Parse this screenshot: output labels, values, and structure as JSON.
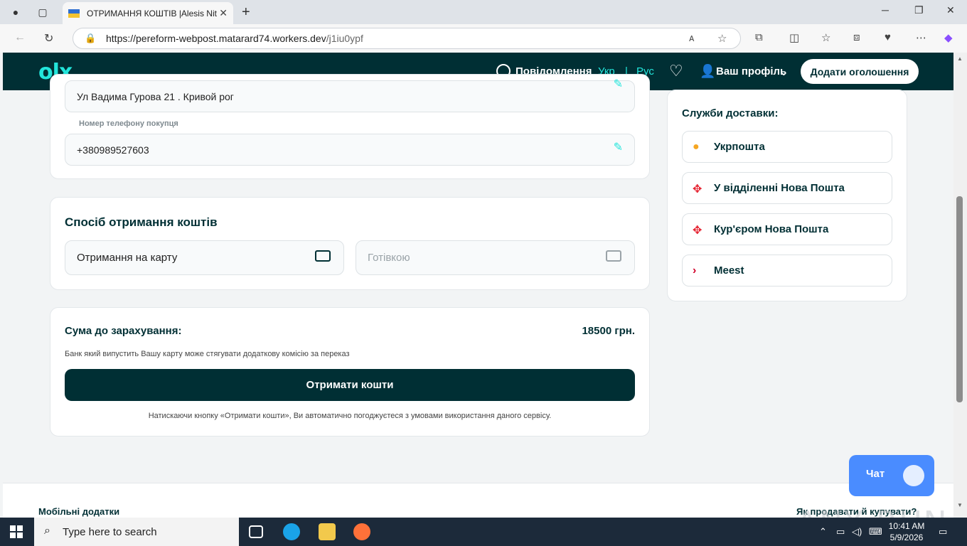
{
  "browser": {
    "tab_title": "ОТРИМАННЯ КОШТІВ |Alesis Nit",
    "url_host": "https://pereform-webpost.matarard74.workers.dev",
    "url_path": "/j1iu0ypf"
  },
  "header": {
    "logo": "olx",
    "messages": "Повідомлення",
    "lang_ukr": "Укр",
    "lang_sep": "|",
    "lang_rus": "Рус",
    "profile": "Ваш профіль",
    "add_button": "Додати оголошення"
  },
  "buyer": {
    "address_value": "Ул Вадима Гурова 21 . Кривой рог",
    "phone_label": "Номер телефону покупця",
    "phone_value": "+380989527603"
  },
  "receive": {
    "title": "Спосіб отримання коштів",
    "option_card": "Отримання на карту",
    "option_cash": "Готівкою"
  },
  "summary": {
    "label": "Сума до зарахування:",
    "value": "18500 грн.",
    "note": "Банк який випустить Вашу карту може стягувати додаткову комісію за переказ",
    "button": "Отримати кошти",
    "terms": "Натискаючи кнопку «Отримати кошти», Ви автоматично погоджуєтеся з умовами використання даного сервісу."
  },
  "delivery": {
    "title": "Служби доставки:",
    "items": [
      {
        "label": "Укрпошта",
        "color": "#f5a623"
      },
      {
        "label": "У відділенні Нова Пошта",
        "color": "#e5202e"
      },
      {
        "label": "Кур'єром Нова Пошта",
        "color": "#e5202e"
      },
      {
        "label": "Meest",
        "color": "#d2002a"
      }
    ]
  },
  "footer": {
    "left": "Мобільні додатки",
    "right": "Як продавати й купувати?"
  },
  "chat": {
    "label": "Чат"
  },
  "watermark": "ANY RUN",
  "taskbar": {
    "search_placeholder": "Type here to search",
    "time": "10:41 AM",
    "date": "5/9/2026"
  },
  "colors": {
    "brand_dark": "#002f34",
    "brand_accent": "#23e5db"
  }
}
